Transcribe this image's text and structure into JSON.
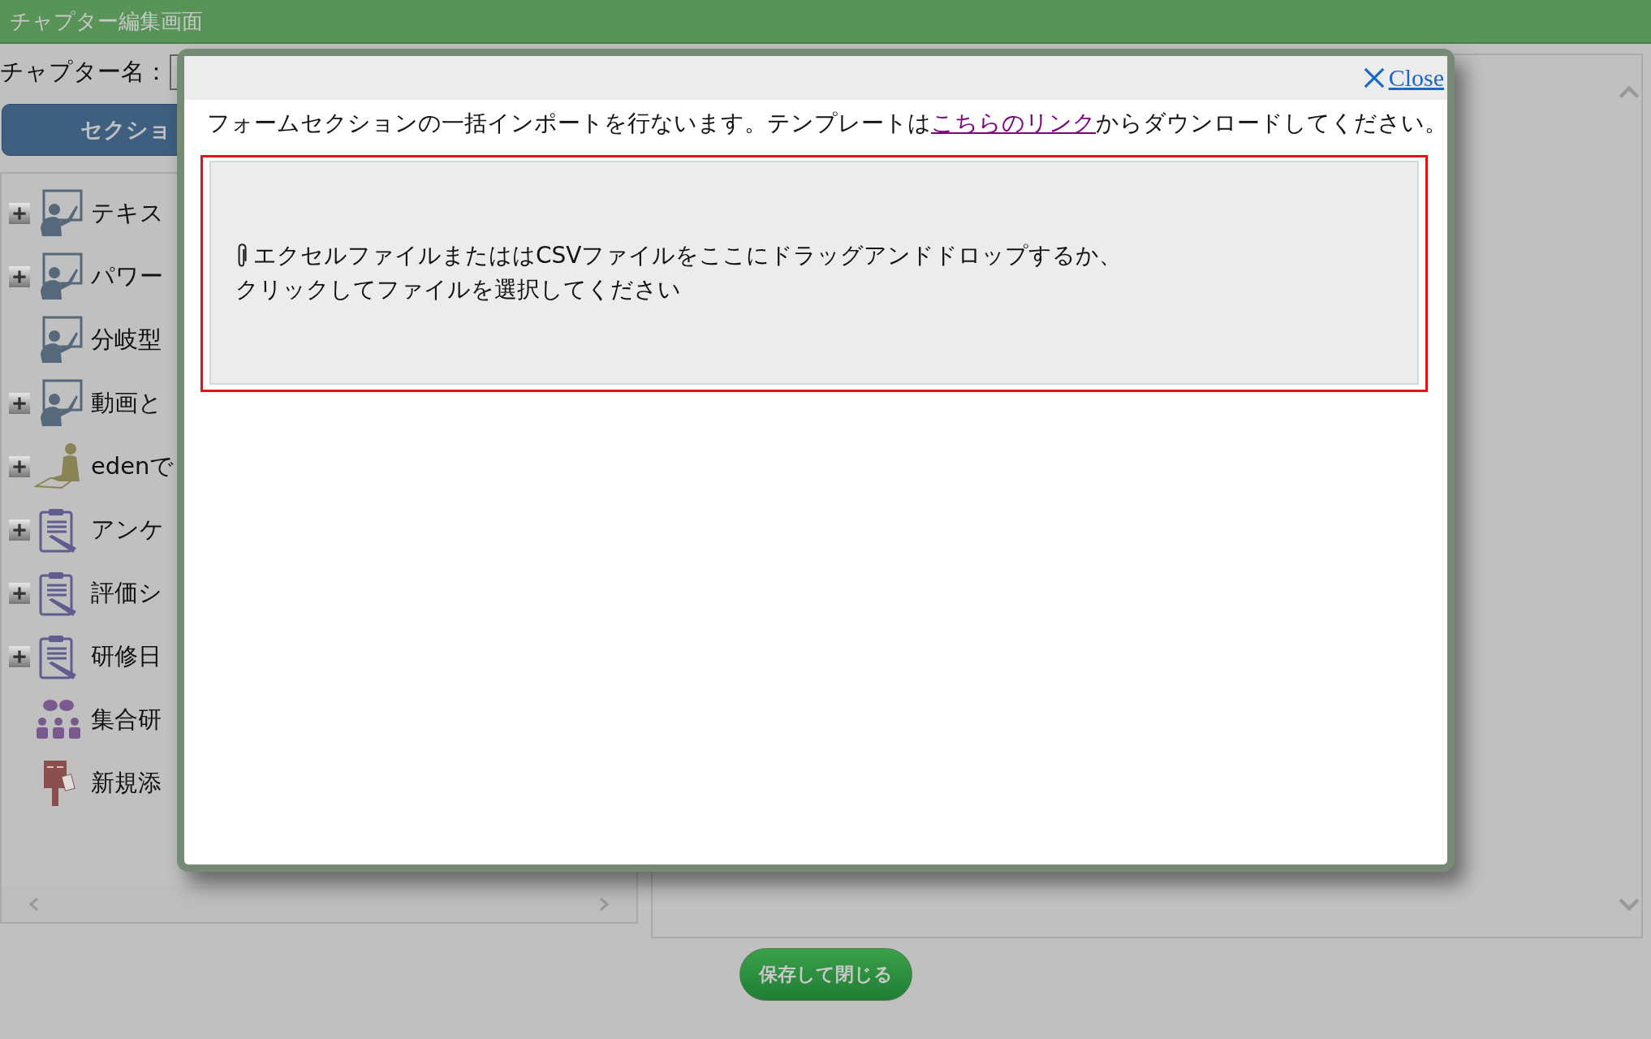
{
  "header": {
    "title": "チャプター編集画面"
  },
  "chapter_name": {
    "label": "チャプター名："
  },
  "section_button": {
    "label": "セクショ"
  },
  "tree": {
    "items": [
      {
        "label": "テキス",
        "kind": "presenter",
        "expandable": true
      },
      {
        "label": "パワー",
        "kind": "presenter",
        "expandable": true
      },
      {
        "label": "分岐型",
        "kind": "presenter",
        "expandable": false
      },
      {
        "label": "動画と",
        "kind": "presenter",
        "expandable": true
      },
      {
        "label": "edenで",
        "kind": "writer",
        "expandable": true
      },
      {
        "label": "アンケ",
        "kind": "clipboard",
        "expandable": true
      },
      {
        "label": "評価シ",
        "kind": "clipboard",
        "expandable": true
      },
      {
        "label": "研修日",
        "kind": "clipboard",
        "expandable": true
      },
      {
        "label": "集合研",
        "kind": "group",
        "expandable": false
      },
      {
        "label": "新規添",
        "kind": "post",
        "expandable": false
      }
    ]
  },
  "save_button": {
    "label": "保存して閉じる"
  },
  "dialog": {
    "close": "Close",
    "instruction": {
      "before": "フォームセクションの一括インポートを行ないます。テンプレートは",
      "link": "こちらのリンク",
      "after": "からダウンロードしてください。"
    },
    "dropzone": {
      "lines": [
        "エクセルファイルまたははCSVファイルをここにドラッグアンドドロップするか、",
        "クリックしてファイルを選択してください"
      ]
    }
  }
}
